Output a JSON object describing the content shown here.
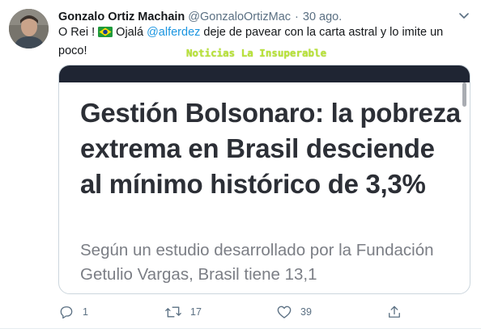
{
  "tweet": {
    "author": {
      "name": "Gonzalo Ortiz Machain",
      "handle": "@GonzaloOrtizMac",
      "separator": "·",
      "date": "30 ago."
    },
    "text": {
      "part1": "O Rei  ! ",
      "part2": " Ojalá ",
      "mention": "@alferdez",
      "part3": " deje de pavear con la carta astral y lo imite un poco!"
    },
    "watermark": "Noticias La Insuperable",
    "card": {
      "headline": "Gestión Bolsonaro: la pobreza extrema en Brasil desciende al mínimo histórico de 3,3%",
      "lead": "Según un estudio desarrollado por la Fundación Getulio Vargas, Brasil tiene 13,1"
    },
    "actions": {
      "reply_count": "1",
      "retweet_count": "17",
      "like_count": "39"
    }
  },
  "icons": {
    "flag": "brazil-flag-icon",
    "caret": "chevron-down-icon",
    "reply": "reply-icon",
    "retweet": "retweet-icon",
    "like": "heart-icon",
    "share": "share-icon"
  },
  "colors": {
    "link": "#1b95e0",
    "secondary_text": "#5b7083",
    "watermark": "#b9e33a",
    "card_topbar": "#1f2533",
    "headline": "#2c2f36"
  }
}
